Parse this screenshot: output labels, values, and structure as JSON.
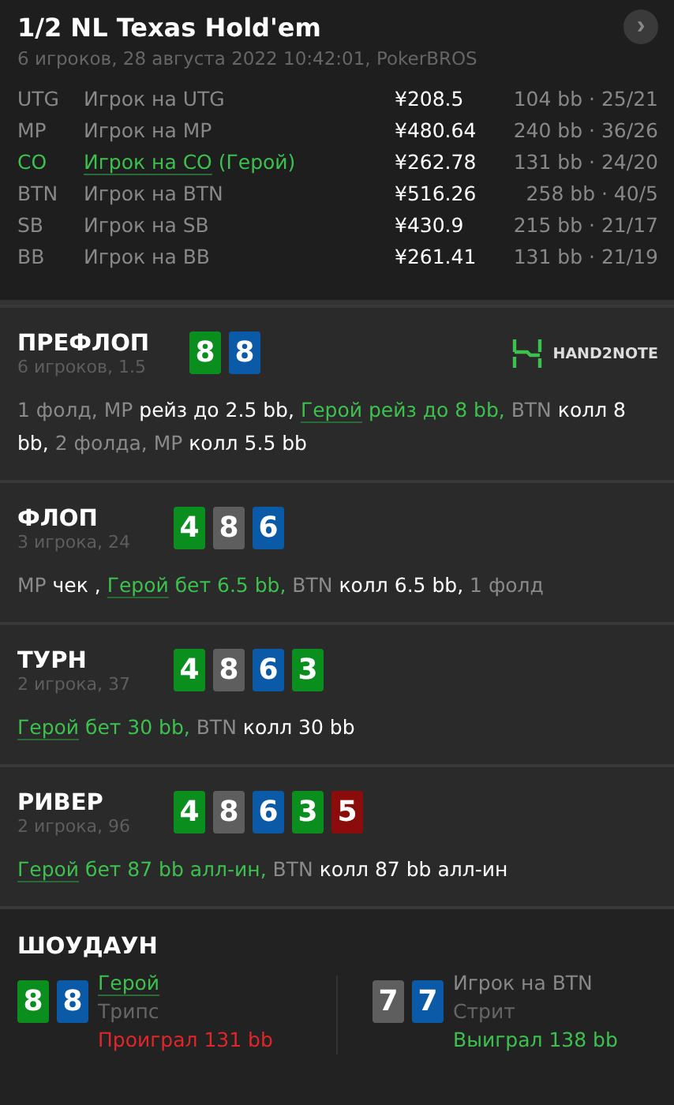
{
  "header": {
    "title": "1/2 NL Texas Hold'em",
    "subtitle": "6 игроков, 28 августа 2022 10:42:01, PokerBROS",
    "next_icon": "›"
  },
  "players": [
    {
      "position": "UTG",
      "name": "Игрок на UTG",
      "hero": false,
      "stack": "¥208.5",
      "stats": "104 bb · 25/21"
    },
    {
      "position": "MP",
      "name": "Игрок на MP",
      "hero": false,
      "stack": "¥480.64",
      "stats": "240 bb · 36/26"
    },
    {
      "position": "CO",
      "name": "Игрок на CO",
      "hero_mark": "(Герой)",
      "hero": true,
      "stack": "¥262.78",
      "stats": "131 bb · 24/20"
    },
    {
      "position": "BTN",
      "name": "Игрок на BTN",
      "hero": false,
      "stack": "¥516.26",
      "stats": "258 bb · 40/5"
    },
    {
      "position": "SB",
      "name": "Игрок на SB",
      "hero": false,
      "stack": "¥430.9",
      "stats": "215 bb · 21/17"
    },
    {
      "position": "BB",
      "name": "Игрок на BB",
      "hero": false,
      "stack": "¥261.41",
      "stats": "131 bb · 21/19"
    }
  ],
  "streets": [
    {
      "title": "ПРЕФЛОП",
      "subtitle": "6 игроков, 1.5",
      "logo": "HAND2NOTE",
      "cards": [
        {
          "rank": "8",
          "color": "#0a8f1f"
        },
        {
          "rank": "8",
          "color": "#0b5aa8"
        }
      ],
      "actions": [
        {
          "kind": "muted",
          "text": "1 фолд, MP "
        },
        {
          "kind": "text",
          "text": "рейз до 2.5 bb, "
        },
        {
          "kind": "hero-link",
          "text": "Герой"
        },
        {
          "kind": "hero",
          "text": " рейз до 8 bb, "
        },
        {
          "kind": "muted",
          "text": "BTN "
        },
        {
          "kind": "text",
          "text": "колл 8 bb, "
        },
        {
          "kind": "muted",
          "text": "2 фолда, MP "
        },
        {
          "kind": "text",
          "text": "колл 5.5 bb"
        }
      ]
    },
    {
      "title": "ФЛОП",
      "subtitle": "3 игрока, 24",
      "cards": [
        {
          "rank": "4",
          "color": "#0a8f1f"
        },
        {
          "rank": "8",
          "color": "#5e5e5e"
        },
        {
          "rank": "6",
          "color": "#0b5aa8"
        }
      ],
      "actions": [
        {
          "kind": "muted",
          "text": "MP "
        },
        {
          "kind": "text",
          "text": "чек , "
        },
        {
          "kind": "hero-link",
          "text": "Герой"
        },
        {
          "kind": "hero",
          "text": " бет 6.5 bb, "
        },
        {
          "kind": "muted",
          "text": "BTN "
        },
        {
          "kind": "text",
          "text": "колл 6.5 bb, "
        },
        {
          "kind": "muted",
          "text": "1 фолд"
        }
      ]
    },
    {
      "title": "ТУРН",
      "subtitle": "2 игрока, 37",
      "cards": [
        {
          "rank": "4",
          "color": "#0a8f1f"
        },
        {
          "rank": "8",
          "color": "#5e5e5e"
        },
        {
          "rank": "6",
          "color": "#0b5aa8"
        },
        {
          "rank": "3",
          "color": "#0a8f1f"
        }
      ],
      "actions": [
        {
          "kind": "hero-link",
          "text": "Герой"
        },
        {
          "kind": "hero",
          "text": " бет 30 bb, "
        },
        {
          "kind": "muted",
          "text": "BTN "
        },
        {
          "kind": "text",
          "text": "колл 30 bb"
        }
      ]
    },
    {
      "title": "РИВЕР",
      "subtitle": "2 игрока, 96",
      "cards": [
        {
          "rank": "4",
          "color": "#0a8f1f"
        },
        {
          "rank": "8",
          "color": "#5e5e5e"
        },
        {
          "rank": "6",
          "color": "#0b5aa8"
        },
        {
          "rank": "3",
          "color": "#0a8f1f"
        },
        {
          "rank": "5",
          "color": "#8c0b0b"
        }
      ],
      "actions": [
        {
          "kind": "hero-link",
          "text": "Герой"
        },
        {
          "kind": "hero",
          "text": " бет 87 bb алл-ин, "
        },
        {
          "kind": "muted",
          "text": "BTN "
        },
        {
          "kind": "text",
          "text": "колл 87 bb алл-ин"
        }
      ]
    }
  ],
  "showdown": {
    "title": "ШОУДАУН",
    "hands": [
      {
        "name": "Герой",
        "hero": true,
        "combo": "Трипс",
        "result": "Проиграл 131 bb",
        "won": false,
        "cards": [
          {
            "rank": "8",
            "color": "#0a8f1f"
          },
          {
            "rank": "8",
            "color": "#0b5aa8"
          }
        ]
      },
      {
        "name": "Игрок на BTN",
        "hero": false,
        "combo": "Стрит",
        "result": "Выиграл 138 bb",
        "won": true,
        "cards": [
          {
            "rank": "7",
            "color": "#5e5e5e"
          },
          {
            "rank": "7",
            "color": "#0b5aa8"
          }
        ]
      }
    ]
  }
}
